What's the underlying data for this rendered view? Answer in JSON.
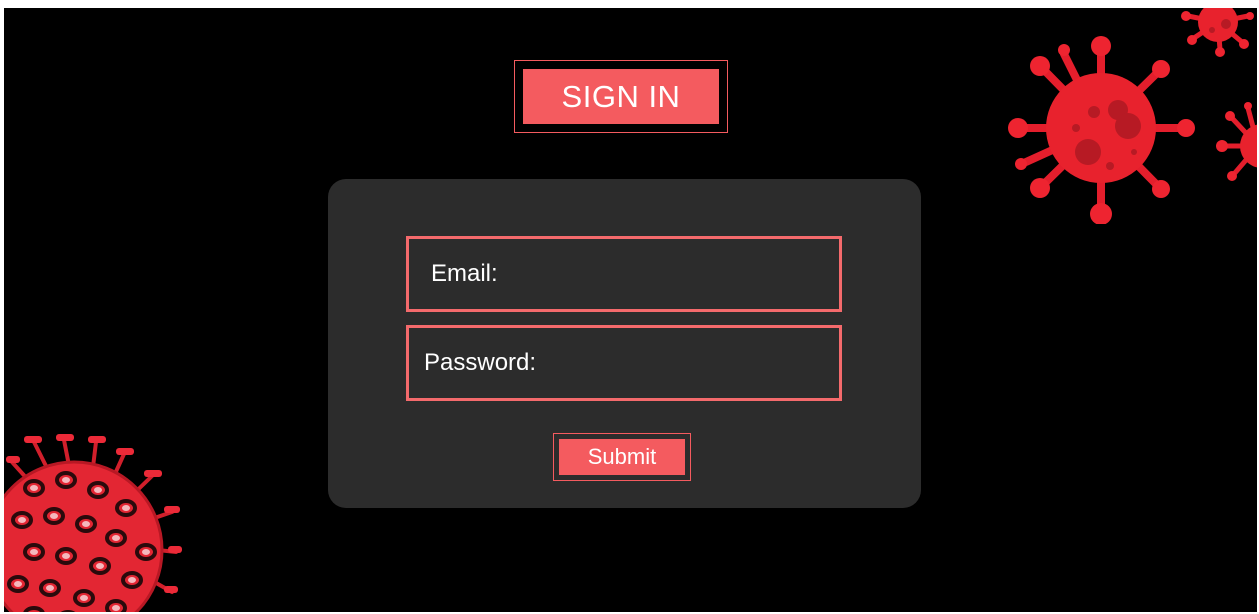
{
  "header": {
    "title": "SIGN IN"
  },
  "form": {
    "email_label": "Email:",
    "password_label": "Password:",
    "submit_label": "Submit"
  },
  "decorations": {
    "icons": [
      "virus-icon",
      "virus-icon",
      "virus-icon",
      "virus-cluster-icon"
    ],
    "virus_color": "#ed1c24"
  },
  "colors": {
    "background": "#000000",
    "card": "#2c2c2c",
    "accent": "#f45b5f",
    "field_border": "#f46a6c",
    "text": "#ffffff"
  }
}
